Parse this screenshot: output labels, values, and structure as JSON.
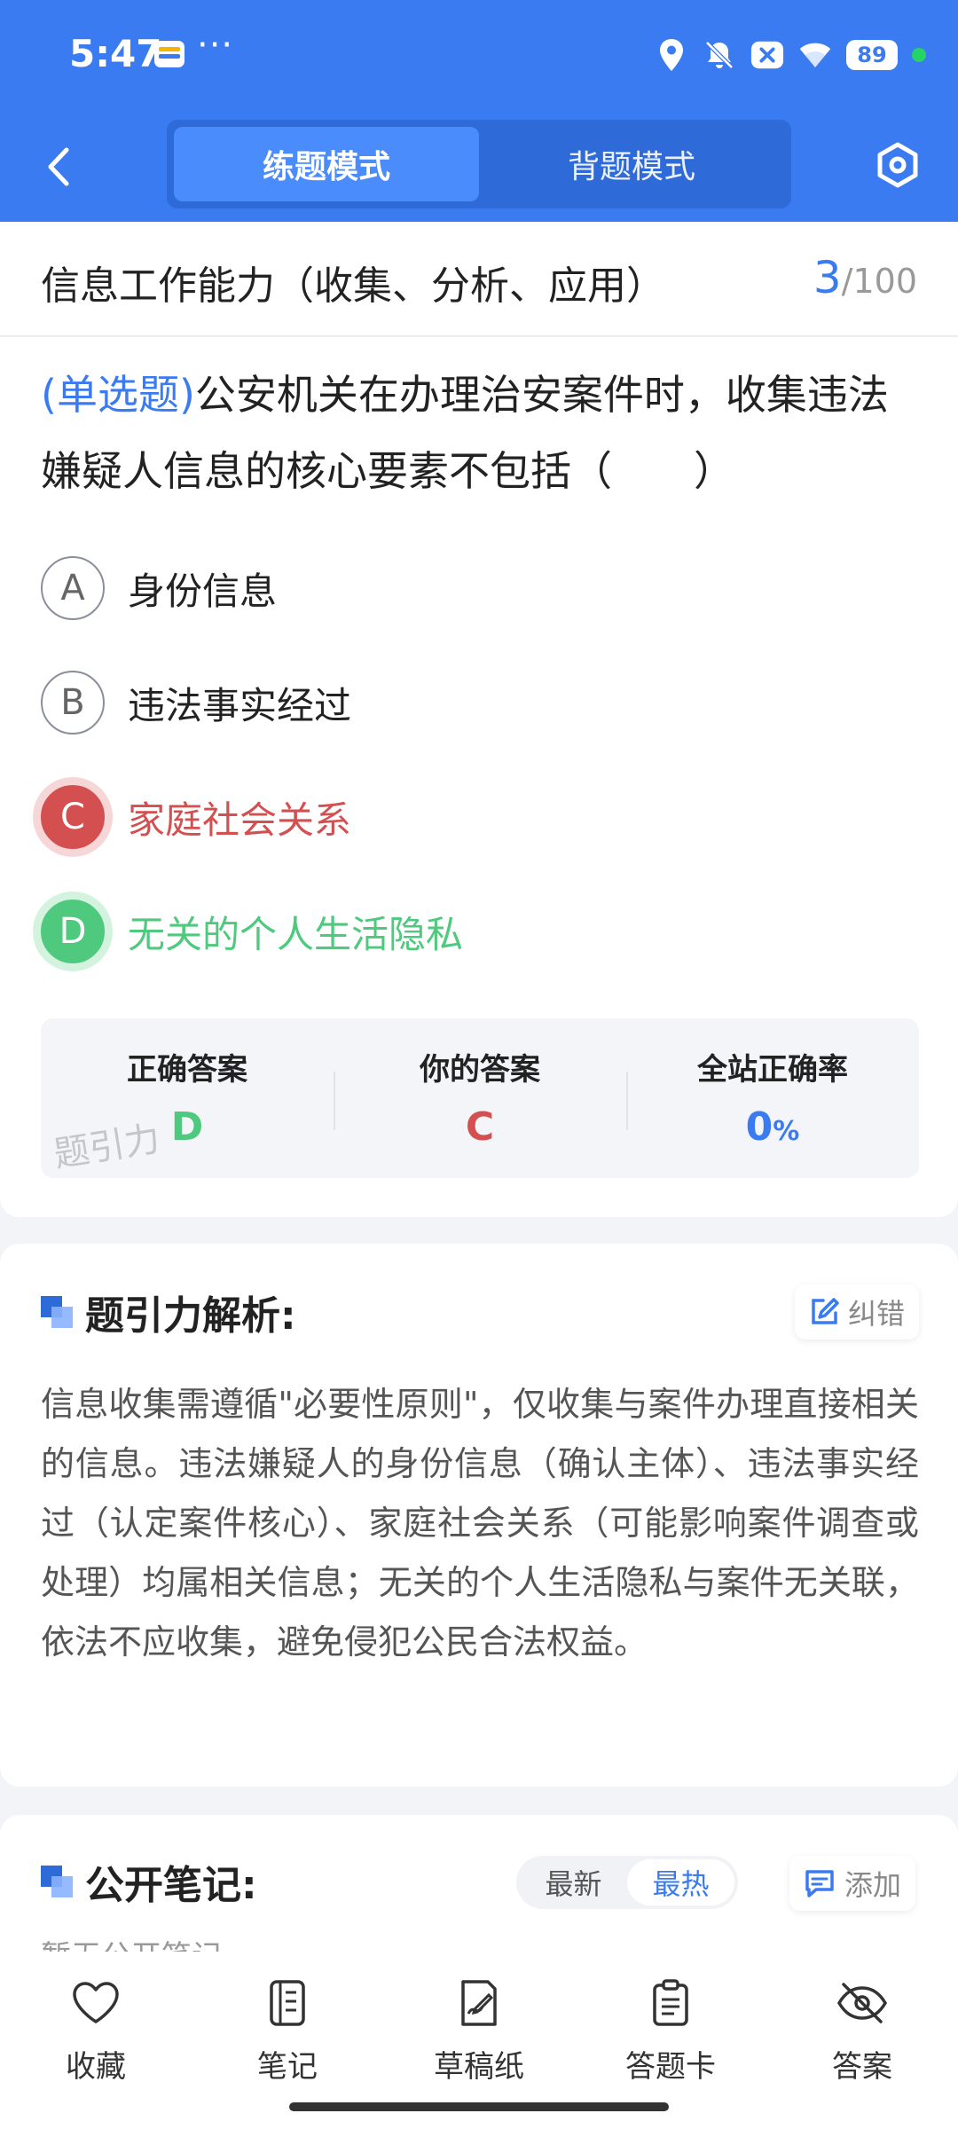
{
  "status_bar": {
    "time": "5:47",
    "more": "···",
    "battery": "89"
  },
  "nav": {
    "modes": [
      "练题模式",
      "背题模式"
    ],
    "active_mode": 0
  },
  "question": {
    "category": "信息工作能力（收集、分析、应用）",
    "current": "3",
    "total": "/100",
    "type": "(单选题)",
    "stem": "公安机关在办理治安案件时，收集违法嫌疑人信息的核心要素不包括（　　）",
    "options": [
      {
        "letter": "A",
        "text": "身份信息",
        "state": "normal"
      },
      {
        "letter": "B",
        "text": "违法事实经过",
        "state": "normal"
      },
      {
        "letter": "C",
        "text": "家庭社会关系",
        "state": "wrong"
      },
      {
        "letter": "D",
        "text": "无关的个人生活隐私",
        "state": "correct"
      }
    ]
  },
  "answer_summary": {
    "correct_label": "正确答案",
    "correct_value": "D",
    "yours_label": "你的答案",
    "yours_value": "C",
    "rate_label": "全站正确率",
    "rate_value": "0",
    "rate_unit": "%",
    "watermark": "题引力"
  },
  "analysis": {
    "title": "题引力解析:",
    "correct_btn": "纠错",
    "text": "信息收集需遵循\"必要性原则\"，仅收集与案件办理直接相关的信息。违法嫌疑人的身份信息（确认主体）、违法事实经过（认定案件核心）、家庭社会关系（可能影响案件调查或处理）均属相关信息；无关的个人生活隐私与案件无关联，依法不应收集，避免侵犯公民合法权益。"
  },
  "notes": {
    "title": "公开笔记:",
    "sort": [
      "最新",
      "最热"
    ],
    "active_sort": 1,
    "add_btn": "添加",
    "empty_text": "暂无公开笔记"
  },
  "bottom_tabs": [
    {
      "label": "收藏",
      "icon": "heart-icon"
    },
    {
      "label": "笔记",
      "icon": "notebook-icon"
    },
    {
      "label": "草稿纸",
      "icon": "draft-paper-icon"
    },
    {
      "label": "答题卡",
      "icon": "answer-card-icon"
    },
    {
      "label": "答案",
      "icon": "eye-off-icon"
    }
  ],
  "colors": {
    "primary": "#3b7bf2",
    "wrong": "#d44f4f",
    "correct": "#4fc97e"
  }
}
